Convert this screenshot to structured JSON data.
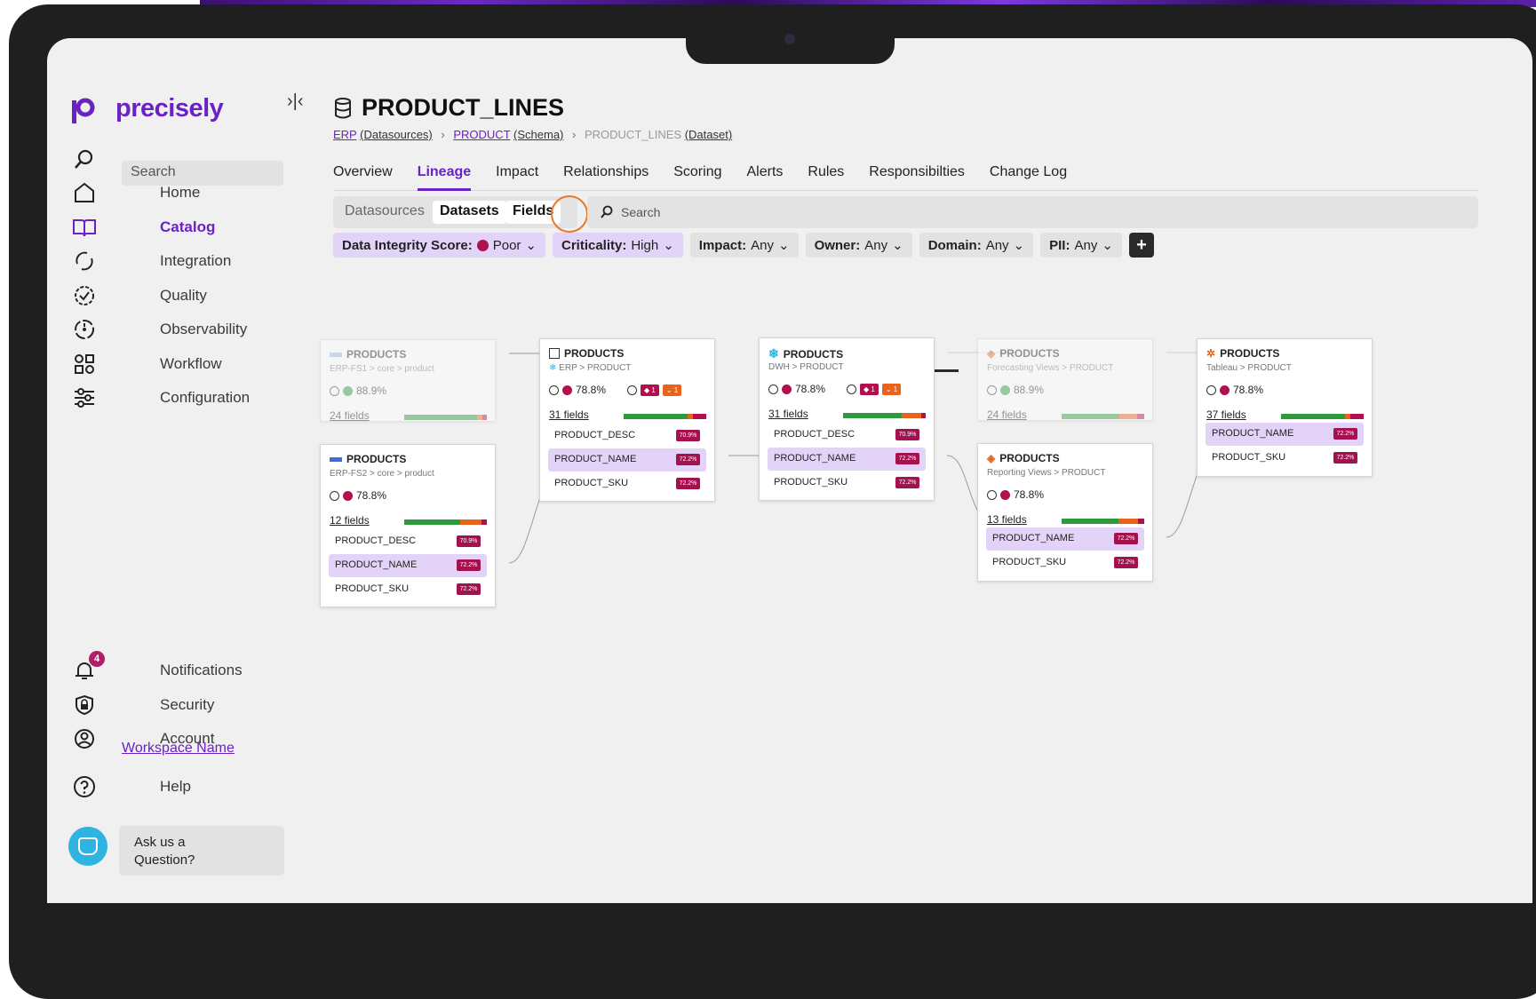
{
  "app": {
    "brand": "precisely",
    "collapse_icon": "collapse-icon"
  },
  "sidebar": {
    "search_placeholder": "Search",
    "items": [
      {
        "label": "Home",
        "icon": "home-icon"
      },
      {
        "label": "Catalog",
        "icon": "book-icon",
        "active": true
      },
      {
        "label": "Integration",
        "icon": "integration-icon"
      },
      {
        "label": "Quality",
        "icon": "quality-icon"
      },
      {
        "label": "Observability",
        "icon": "observability-icon"
      },
      {
        "label": "Workflow",
        "icon": "workflow-icon"
      },
      {
        "label": "Configuration",
        "icon": "sliders-icon"
      }
    ],
    "bottom": {
      "notifications": "Notifications",
      "notification_count": "4",
      "security": "Security",
      "account": "Account",
      "workspace": "Workspace Name",
      "help": "Help",
      "ask_line1": "Ask us a",
      "ask_line2": "Question?"
    }
  },
  "page": {
    "title": "PRODUCT_LINES",
    "breadcrumb": {
      "c1": "ERP",
      "c1_type": "(Datasources)",
      "c2": "PRODUCT",
      "c2_type": "(Schema)",
      "c3": "PRODUCT_LINES",
      "c3_type": "(Dataset)"
    },
    "tabs": [
      "Overview",
      "Lineage",
      "Impact",
      "Relationships",
      "Scoring",
      "Alerts",
      "Rules",
      "Responsibilties",
      "Change Log"
    ],
    "active_tab": "Lineage",
    "segments": [
      "Datasources",
      "Datasets",
      "Fields"
    ],
    "search_placeholder": "Search",
    "filters": {
      "f1_label": "Data Integrity Score:",
      "f1_value": "Poor",
      "f2_label": "Criticality:",
      "f2_value": "High",
      "f3_label": "Impact:",
      "f3_value": "Any",
      "f4_label": "Owner:",
      "f4_value": "Any",
      "f5_label": "Domain:",
      "f5_value": "Any",
      "f6_label": "PII:",
      "f6_value": "Any"
    }
  },
  "lineage": {
    "n1": {
      "name": "PRODUCTS",
      "path": "ERP-FS1 > core > product",
      "score": "88.9%",
      "fields": "24 fields"
    },
    "n2": {
      "name": "PRODUCTS",
      "path": "ERP-FS2 > core > product",
      "score": "78.8%",
      "fields": "12 fields",
      "rows": [
        {
          "name": "PRODUCT_DESC",
          "pct": "70.9%"
        },
        {
          "name": "PRODUCT_NAME",
          "pct": "72.2%"
        },
        {
          "name": "PRODUCT_SKU",
          "pct": "72.2%"
        }
      ]
    },
    "n3": {
      "name": "PRODUCTS",
      "path": "ERP > PRODUCT",
      "score": "78.8%",
      "fields": "31 fields",
      "b1": "1",
      "b2": "1",
      "rows": [
        {
          "name": "PRODUCT_DESC",
          "pct": "70.9%"
        },
        {
          "name": "PRODUCT_NAME",
          "pct": "72.2%"
        },
        {
          "name": "PRODUCT_SKU",
          "pct": "72.2%"
        }
      ]
    },
    "n4": {
      "name": "PRODUCTS",
      "path": "DWH > PRODUCT",
      "score": "78.8%",
      "fields": "31 fields",
      "b1": "1",
      "b2": "1",
      "rows": [
        {
          "name": "PRODUCT_DESC",
          "pct": "70.9%"
        },
        {
          "name": "PRODUCT_NAME",
          "pct": "72.2%"
        },
        {
          "name": "PRODUCT_SKU",
          "pct": "72.2%"
        }
      ]
    },
    "n5": {
      "name": "PRODUCTS",
      "path": "Forecasting Views > PRODUCT",
      "score": "88.9%",
      "fields": "24 fields"
    },
    "n6": {
      "name": "PRODUCTS",
      "path": "Reporting Views > PRODUCT",
      "score": "78.8%",
      "fields": "13 fields",
      "rows": [
        {
          "name": "PRODUCT_NAME",
          "pct": "72.2%"
        },
        {
          "name": "PRODUCT_SKU",
          "pct": "72.2%"
        }
      ]
    },
    "n7": {
      "name": "PRODUCTS",
      "path": "Tableau > PRODUCT",
      "score": "78.8%",
      "fields": "37 fields",
      "rows": [
        {
          "name": "PRODUCT_NAME",
          "pct": "72.2%"
        },
        {
          "name": "PRODUCT_SKU",
          "pct": "72.2%"
        }
      ]
    }
  },
  "colors": {
    "brand": "#6b22c5",
    "poor": "#b0104e",
    "warn": "#e8641d",
    "good": "#2e9a3c",
    "highlight": "#e4d3f8"
  }
}
